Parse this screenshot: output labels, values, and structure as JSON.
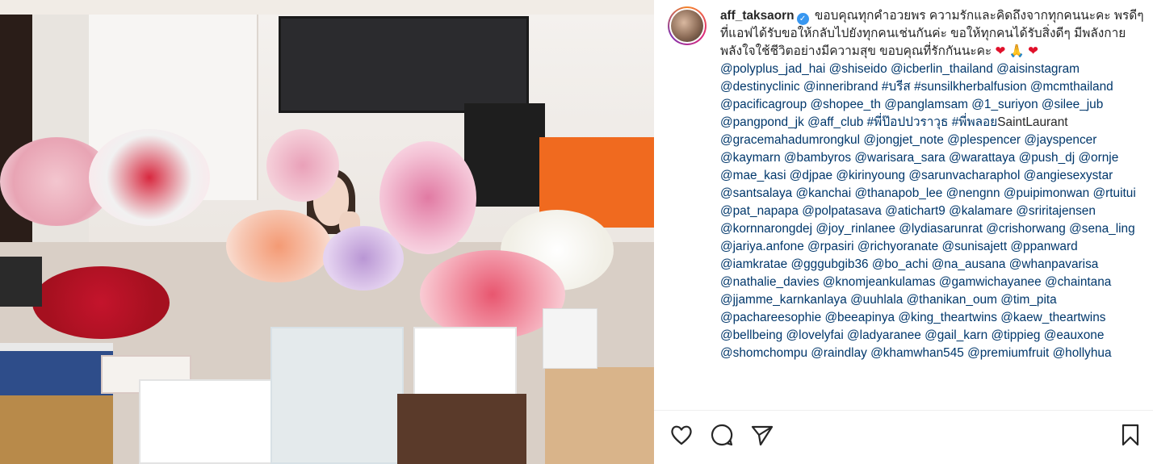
{
  "post": {
    "username": "aff_taksaorn",
    "verified_mark": "✓",
    "caption_intro": "ขอบคุณทุกคำอวยพร ความรักและคิดถึงจากทุกคนนะคะ พรดีๆที่แอฟได้รับขอให้กลับไปยังทุกคนเช่นกันค่ะ ขอให้ทุกคนได้รับสิ่งดีๆ มีพลังกายพลังใจใช้ชีวิตอย่างมีความสุข ขอบคุณที่รักกันนะคะ",
    "emojis": [
      "❤",
      "🙏",
      "❤"
    ],
    "tags": [
      {
        "type": "mention",
        "text": "@polyplus_jad_hai"
      },
      {
        "type": "mention",
        "text": "@shiseido"
      },
      {
        "type": "mention",
        "text": "@icberlin_thailand"
      },
      {
        "type": "mention",
        "text": "@aisinstagram"
      },
      {
        "type": "mention",
        "text": "@destinyclinic"
      },
      {
        "type": "mention",
        "text": "@inneribrand"
      },
      {
        "type": "hashtag",
        "text": "#บรีส"
      },
      {
        "type": "mention",
        "text": "#sunsilkherbalfusion"
      },
      {
        "type": "mention",
        "text": "@mcmthailand"
      },
      {
        "type": "mention",
        "text": "@pacificagroup"
      },
      {
        "type": "mention",
        "text": "@shopee_th"
      },
      {
        "type": "mention",
        "text": "@panglamsam"
      },
      {
        "type": "mention",
        "text": "@1_suriyon"
      },
      {
        "type": "mention",
        "text": "@silee_jub"
      },
      {
        "type": "mention",
        "text": "@pangpond_jk"
      },
      {
        "type": "mention",
        "text": "@aff_club"
      },
      {
        "type": "hashtag",
        "text": "#พี่ป๊อปปวราวุธ"
      },
      {
        "type": "hashtag",
        "text": "#พี่พลอย"
      },
      {
        "type": "plain",
        "text": "SaintLaurant"
      },
      {
        "type": "mention",
        "text": "@gracemahadumrongkul"
      },
      {
        "type": "mention",
        "text": "@jongjet_note"
      },
      {
        "type": "mention",
        "text": "@plespencer"
      },
      {
        "type": "mention",
        "text": "@jayspencer"
      },
      {
        "type": "mention",
        "text": "@kaymarn"
      },
      {
        "type": "mention",
        "text": "@bambyros"
      },
      {
        "type": "mention",
        "text": "@warisara_sara"
      },
      {
        "type": "mention",
        "text": "@warattaya"
      },
      {
        "type": "mention",
        "text": "@push_dj"
      },
      {
        "type": "mention",
        "text": "@ornje"
      },
      {
        "type": "mention",
        "text": "@mae_kasi"
      },
      {
        "type": "mention",
        "text": "@djpae"
      },
      {
        "type": "mention",
        "text": "@kirinyoung"
      },
      {
        "type": "mention",
        "text": "@sarunvacharaphol"
      },
      {
        "type": "mention",
        "text": "@angiesexystar"
      },
      {
        "type": "mention",
        "text": "@santsalaya"
      },
      {
        "type": "mention",
        "text": "@kanchai"
      },
      {
        "type": "mention",
        "text": "@thanapob_lee"
      },
      {
        "type": "mention",
        "text": "@nengnn"
      },
      {
        "type": "mention",
        "text": "@puipimonwan"
      },
      {
        "type": "mention",
        "text": "@rtuitui"
      },
      {
        "type": "mention",
        "text": "@pat_napapa"
      },
      {
        "type": "mention",
        "text": "@polpatasava"
      },
      {
        "type": "mention",
        "text": "@atichart9"
      },
      {
        "type": "mention",
        "text": "@kalamare"
      },
      {
        "type": "mention",
        "text": "@sriritajensen"
      },
      {
        "type": "mention",
        "text": "@kornnarongdej"
      },
      {
        "type": "mention",
        "text": "@joy_rinlanee"
      },
      {
        "type": "mention",
        "text": "@lydiasarunrat"
      },
      {
        "type": "mention",
        "text": "@crishorwang"
      },
      {
        "type": "mention",
        "text": "@sena_ling"
      },
      {
        "type": "mention",
        "text": "@jariya.anfone"
      },
      {
        "type": "mention",
        "text": "@rpasiri"
      },
      {
        "type": "mention",
        "text": "@richyoranate"
      },
      {
        "type": "mention",
        "text": "@sunisajett"
      },
      {
        "type": "mention",
        "text": "@ppanward"
      },
      {
        "type": "mention",
        "text": "@iamkratae"
      },
      {
        "type": "mention",
        "text": "@gggubgib36"
      },
      {
        "type": "mention",
        "text": "@bo_achi"
      },
      {
        "type": "mention",
        "text": "@na_ausana"
      },
      {
        "type": "mention",
        "text": "@whanpavarisa"
      },
      {
        "type": "mention",
        "text": "@nathalie_davies"
      },
      {
        "type": "mention",
        "text": "@knomjeankulamas"
      },
      {
        "type": "mention",
        "text": "@gamwichayanee"
      },
      {
        "type": "mention",
        "text": "@chaintana"
      },
      {
        "type": "mention",
        "text": "@jjamme_karnkanlaya"
      },
      {
        "type": "mention",
        "text": "@uuhlala"
      },
      {
        "type": "mention",
        "text": "@thanikan_oum"
      },
      {
        "type": "mention",
        "text": "@tim_pita"
      },
      {
        "type": "mention",
        "text": "@pachareesophie"
      },
      {
        "type": "mention",
        "text": "@beeapinya"
      },
      {
        "type": "mention",
        "text": "@king_theartwins"
      },
      {
        "type": "mention",
        "text": "@kaew_theartwins"
      },
      {
        "type": "mention",
        "text": "@bellbeing"
      },
      {
        "type": "mention",
        "text": "@lovelyfai"
      },
      {
        "type": "mention",
        "text": "@ladyaranee"
      },
      {
        "type": "mention",
        "text": "@gail_karn"
      },
      {
        "type": "mention",
        "text": "@tippieg"
      },
      {
        "type": "mention",
        "text": "@eauxone"
      },
      {
        "type": "mention",
        "text": "@shomchompu"
      },
      {
        "type": "mention",
        "text": "@raindlay"
      },
      {
        "type": "mention",
        "text": "@khamwhan545"
      },
      {
        "type": "mention",
        "text": "@premiumfruit"
      },
      {
        "type": "mention",
        "text": "@hollyhua"
      }
    ]
  },
  "actions": {
    "like_icon": "heart-outline-icon",
    "comment_icon": "comment-bubble-icon",
    "share_icon": "paper-plane-icon",
    "save_icon": "bookmark-icon"
  },
  "colors": {
    "link": "#00376b",
    "text": "#262626",
    "verified": "#3897f0",
    "divider": "#efefef"
  }
}
